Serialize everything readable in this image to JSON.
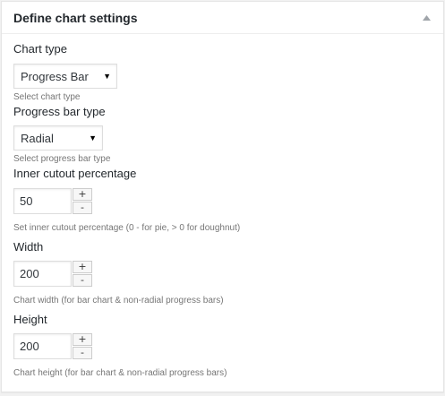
{
  "panel": {
    "title": "Define chart settings",
    "toggle_icon": "triangle-up-icon"
  },
  "fields": {
    "chart_type": {
      "label": "Chart type",
      "selected": "Progress Bar",
      "description": "Select chart type"
    },
    "progress_bar_type": {
      "label": "Progress bar type",
      "selected": "Radial",
      "description": "Select progress bar type"
    },
    "inner_cutout": {
      "label": "Inner cutout percentage",
      "value": "50",
      "increment": "+",
      "decrement": "-",
      "description": "Set inner cutout percentage (0 - for pie, > 0 for doughnut)"
    },
    "width": {
      "label": "Width",
      "value": "200",
      "increment": "+",
      "decrement": "-",
      "description": "Chart width (for bar chart & non-radial progress bars)"
    },
    "height": {
      "label": "Height",
      "value": "200",
      "increment": "+",
      "decrement": "-",
      "description": "Chart height (for bar chart & non-radial progress bars)"
    }
  },
  "colors": {
    "background": "#f1f1f1",
    "panel": "#ffffff",
    "border": "#e5e5e5",
    "text": "#23282d",
    "muted": "#767676"
  }
}
